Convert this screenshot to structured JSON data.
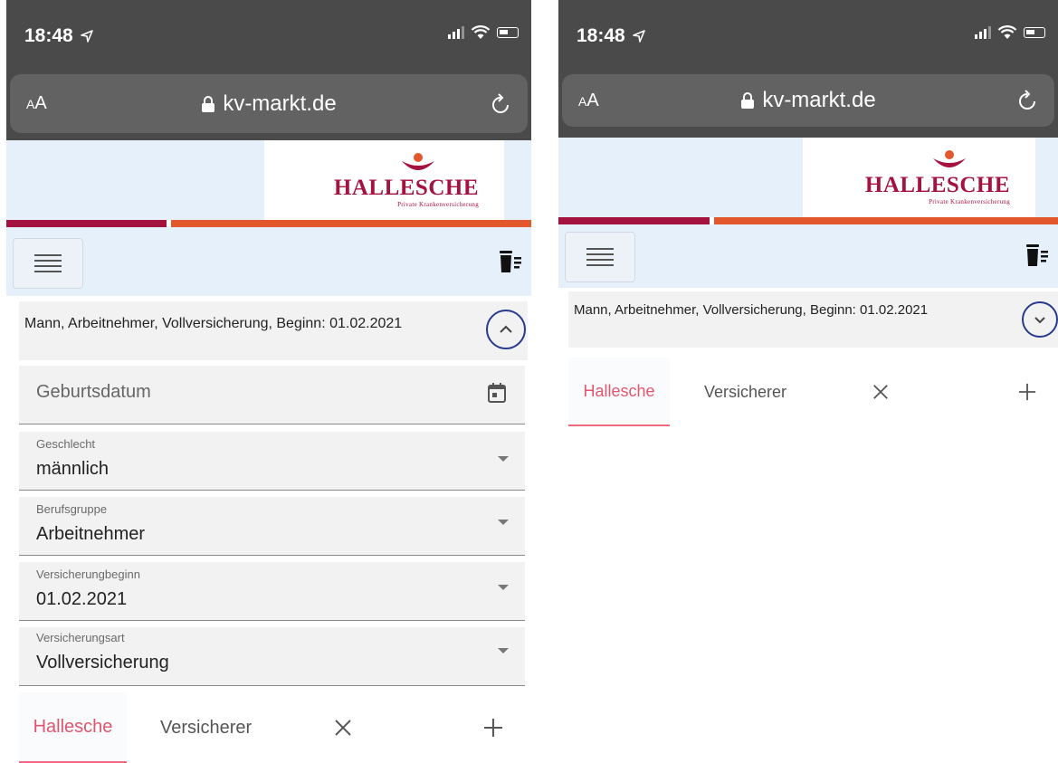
{
  "status_bar": {
    "time": "18:48"
  },
  "browser": {
    "text_size_label_small": "A",
    "text_size_label_large": "A",
    "domain": "kv-markt.de"
  },
  "logo": {
    "name": "HALLESCHE",
    "tagline": "Private Krankenversicherung"
  },
  "summary": {
    "text": "Mann, Arbeitnehmer, Vollversicherung, Beginn: 01.02.2021"
  },
  "form": {
    "birthdate_placeholder": "Geburtsdatum",
    "fields": [
      {
        "label": "Geschlecht",
        "value": "männlich"
      },
      {
        "label": "Berufsgruppe",
        "value": "Arbeitnehmer"
      },
      {
        "label": "Versicherungbeginn",
        "value": "01.02.2021"
      },
      {
        "label": "Versicherungsart",
        "value": "Vollversicherung"
      }
    ]
  },
  "tabs": {
    "active": "Hallesche",
    "second": "Versicherer"
  },
  "colors": {
    "brand": "#a4123f",
    "accent_stripe": "#e3572c",
    "active_tab": "#e0566f",
    "toggle_border": "#283a8c"
  }
}
